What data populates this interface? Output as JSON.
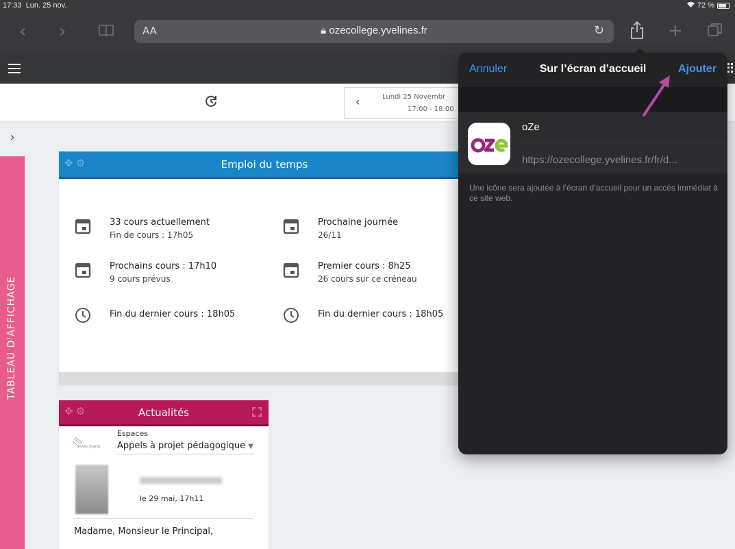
{
  "status": {
    "time": "17:33",
    "date": "Lun. 25 nov.",
    "battery": "72 %"
  },
  "browser": {
    "aa": "AA",
    "url": "ozecollege.yvelines.fr"
  },
  "subbar": {
    "date_line1": "Lundi 25 Novembr",
    "date_line2": "17:00 - 18:00"
  },
  "side_tab": {
    "label": "TABLEAU D'AFFICHAGE"
  },
  "timetable": {
    "title": "Emploi du temps",
    "stats": [
      {
        "icon": "calendar-icon",
        "title": "33 cours actuellement",
        "sub": "Fin de cours : 17h05"
      },
      {
        "icon": "calendar-icon",
        "title": "Prochaine journée",
        "sub": "26/11"
      },
      {
        "icon": "calendar-icon",
        "title": "Prochains cours : 17h10",
        "sub": "9 cours prévus"
      },
      {
        "icon": "calendar-icon",
        "title": "Premier cours : 8h25",
        "sub": "26 cours sur ce créneau"
      },
      {
        "icon": "clock-icon",
        "title": "Fin du dernier cours : 18h05",
        "sub": ""
      },
      {
        "icon": "clock-icon",
        "title": "Fin du dernier cours : 18h05",
        "sub": ""
      }
    ]
  },
  "news": {
    "title": "Actualités",
    "logo_text": "YVELINES",
    "spaces_label": "Espaces",
    "spaces_value": "Appels à projet pédagogique",
    "post_date": "le 29 mai, 17h11",
    "message": "Madame, Monsieur le Principal,"
  },
  "sheet": {
    "cancel": "Annuler",
    "title": "Sur l’écran d’accueil",
    "add": "Ajouter",
    "app_name": "oZe",
    "app_url": "https://ozecollege.yvelines.fr/fr/d...",
    "hint": "Une icône sera ajoutée à l’écran d’accueil pour un accès immédiat à ce site web.",
    "icon_text": "oze"
  },
  "colors": {
    "accent": "#3f93ee",
    "timetable_header": "#1a86c8",
    "news_header": "#b61a58",
    "side_tab": "#e95c8e",
    "annotation_arrow": "#b24ba3"
  }
}
